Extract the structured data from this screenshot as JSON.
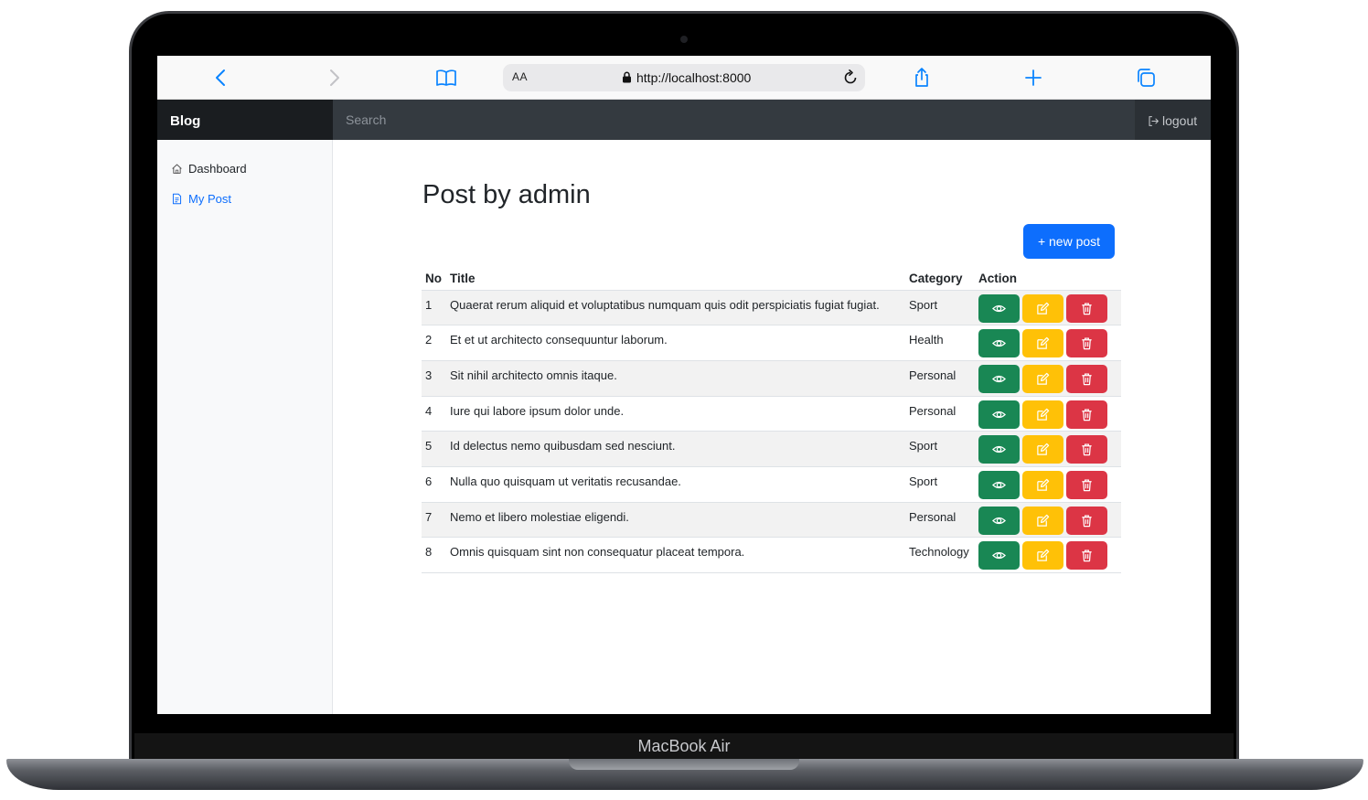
{
  "device": {
    "model_label": "MacBook Air"
  },
  "browser": {
    "aa_label": "AA",
    "url": "http://localhost:8000",
    "icons": [
      "chevron-left-icon",
      "chevron-right-icon",
      "book-icon",
      "lock-icon",
      "reload-icon",
      "share-icon",
      "plus-icon",
      "tabs-icon"
    ]
  },
  "navbar": {
    "brand": "Blog",
    "search_placeholder": "Search",
    "logout_label": "logout"
  },
  "sidebar": {
    "items": [
      {
        "label": "Dashboard",
        "icon": "house-icon",
        "active": false
      },
      {
        "label": "My Post",
        "icon": "file-text-icon",
        "active": true
      }
    ]
  },
  "main": {
    "title": "Post by admin",
    "new_post_label": "+ new post",
    "table": {
      "headers": [
        "No",
        "Title",
        "Category",
        "Action"
      ],
      "rows": [
        {
          "no": "1",
          "title": "Quaerat rerum aliquid et voluptatibus numquam quis odit perspiciatis fugiat fugiat.",
          "category": "Sport"
        },
        {
          "no": "2",
          "title": "Et et ut architecto consequuntur laborum.",
          "category": "Health"
        },
        {
          "no": "3",
          "title": "Sit nihil architecto omnis itaque.",
          "category": "Personal"
        },
        {
          "no": "4",
          "title": "Iure qui labore ipsum dolor unde.",
          "category": "Personal"
        },
        {
          "no": "5",
          "title": "Id delectus nemo quibusdam sed nesciunt.",
          "category": "Sport"
        },
        {
          "no": "6",
          "title": "Nulla quo quisquam ut veritatis recusandae.",
          "category": "Sport"
        },
        {
          "no": "7",
          "title": "Nemo et libero molestiae eligendi.",
          "category": "Personal"
        },
        {
          "no": "8",
          "title": "Omnis quisquam sint non consequatur placeat tempora.",
          "category": "Technology"
        }
      ]
    }
  },
  "colors": {
    "primary": "#0d6efd",
    "view": "#198754",
    "edit": "#ffc107",
    "delete": "#dc3545",
    "navbar": "#212529"
  }
}
